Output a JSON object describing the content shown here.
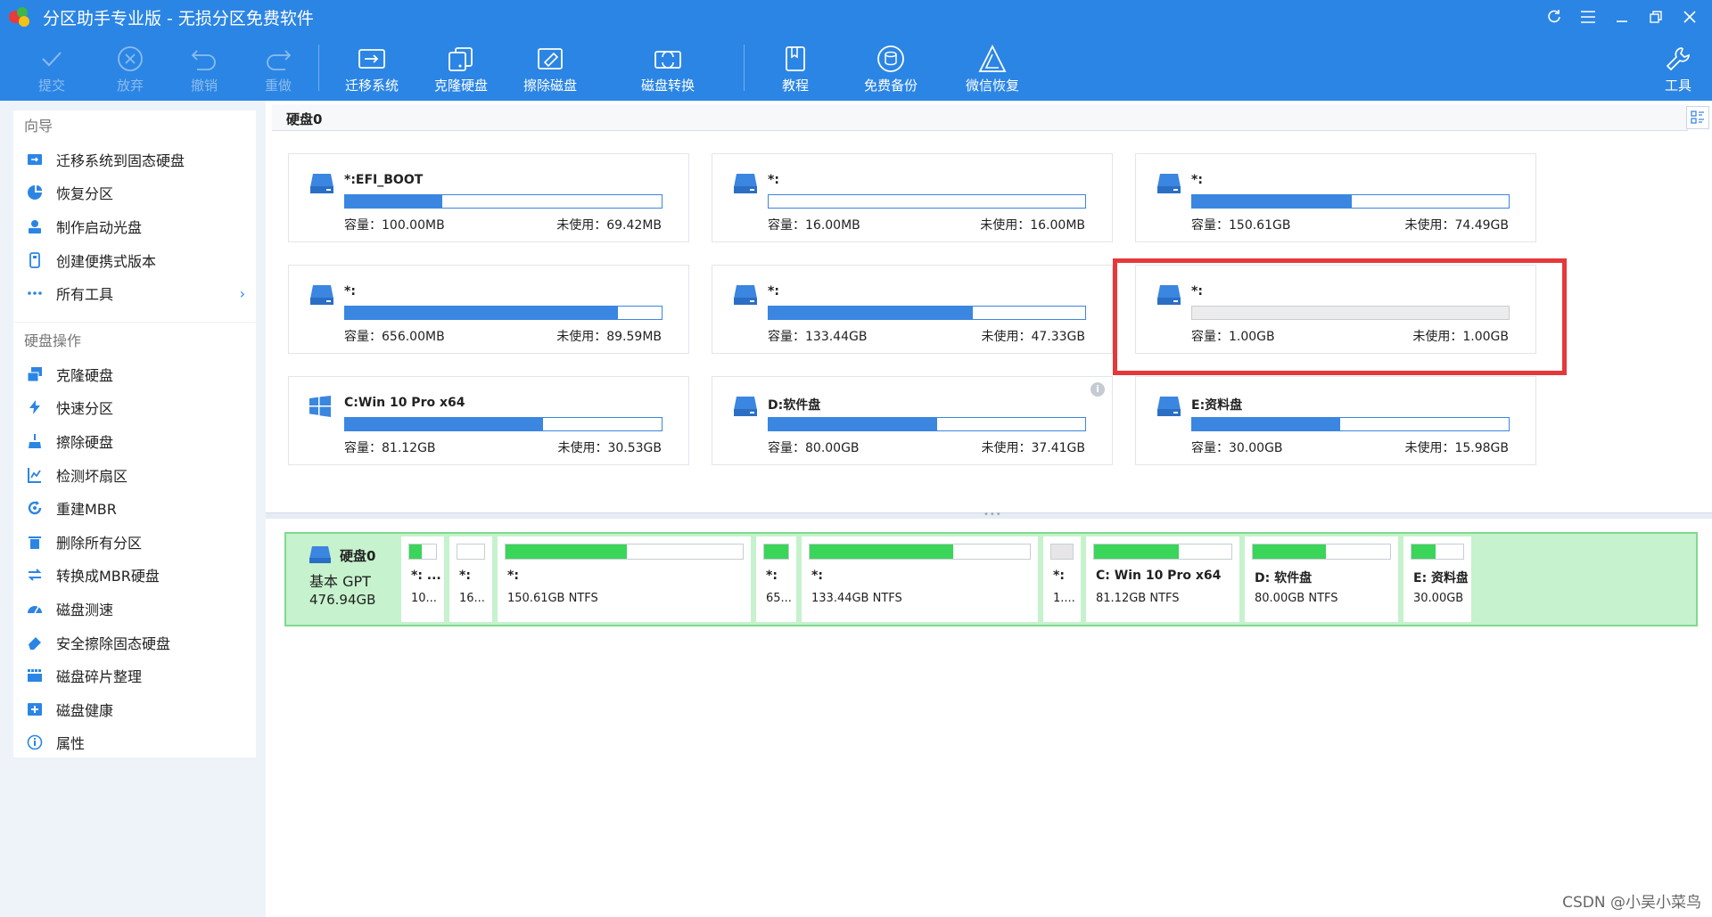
{
  "window": {
    "title": "分区助手专业版 - 无损分区免费软件"
  },
  "toolbar": {
    "commit": "提交",
    "discard": "放弃",
    "undo": "撤销",
    "redo": "重做",
    "migrate_os": "迁移系统",
    "clone_disk": "克隆硬盘",
    "wipe_disk": "擦除磁盘",
    "disk_convert": "磁盘转换",
    "tutorial": "教程",
    "free_backup": "免费备份",
    "wechat_recover": "微信恢复",
    "tools": "工具"
  },
  "sidebar": {
    "wizard_title": "向导",
    "wizard_items": [
      {
        "label": "迁移系统到固态硬盘",
        "icon": "migrate-ssd-icon"
      },
      {
        "label": "恢复分区",
        "icon": "pie-recover-icon"
      },
      {
        "label": "制作启动光盘",
        "icon": "boot-disc-icon"
      },
      {
        "label": "创建便携式版本",
        "icon": "usb-portable-icon"
      },
      {
        "label": "所有工具",
        "icon": "more-dots-icon"
      }
    ],
    "disk_ops_title": "硬盘操作",
    "disk_ops_items": [
      {
        "label": "克隆硬盘",
        "icon": "clone-disk-icon"
      },
      {
        "label": "快速分区",
        "icon": "lightning-icon"
      },
      {
        "label": "擦除硬盘",
        "icon": "broom-icon"
      },
      {
        "label": "检测坏扇区",
        "icon": "bad-sector-icon"
      },
      {
        "label": "重建MBR",
        "icon": "rebuild-mbr-icon"
      },
      {
        "label": "删除所有分区",
        "icon": "trash-icon"
      },
      {
        "label": "转换成MBR硬盘",
        "icon": "convert-icon"
      },
      {
        "label": "磁盘测速",
        "icon": "speedometer-icon"
      },
      {
        "label": "安全擦除固态硬盘",
        "icon": "eraser-icon"
      },
      {
        "label": "磁盘碎片整理",
        "icon": "defrag-icon"
      },
      {
        "label": "磁盘健康",
        "icon": "disk-health-icon"
      },
      {
        "label": "属性",
        "icon": "info-icon"
      }
    ]
  },
  "main": {
    "disk_title": "硬盘0",
    "cards": [
      {
        "name": "*:EFI_BOOT",
        "capacity": "容量：100.00MB",
        "free": "未使用：69.42MB",
        "used_fraction": 0.306,
        "icon": "disk-icon"
      },
      {
        "name": "*:",
        "capacity": "容量：16.00MB",
        "free": "未使用：16.00MB",
        "used_fraction": 0.0,
        "icon": "disk-icon"
      },
      {
        "name": "*:",
        "capacity": "容量：150.61GB",
        "free": "未使用：74.49GB",
        "used_fraction": 0.505,
        "icon": "disk-icon"
      },
      {
        "name": "*:",
        "capacity": "容量：656.00MB",
        "free": "未使用：89.59MB",
        "used_fraction": 0.863,
        "icon": "disk-icon"
      },
      {
        "name": "*:",
        "capacity": "容量：133.44GB",
        "free": "未使用：47.33GB",
        "used_fraction": 0.645,
        "icon": "disk-icon"
      },
      {
        "name": "*:",
        "capacity": "容量：1.00GB",
        "free": "未使用：1.00GB",
        "used_fraction": 0.0,
        "icon": "disk-icon",
        "unallocated": true
      },
      {
        "name": "C:Win 10 Pro x64",
        "capacity": "容量：81.12GB",
        "free": "未使用：30.53GB",
        "used_fraction": 0.624,
        "icon": "windows-icon"
      },
      {
        "name": "D:软件盘",
        "capacity": "容量：80.00GB",
        "free": "未使用：37.41GB",
        "used_fraction": 0.532,
        "icon": "disk-icon",
        "info": "i"
      },
      {
        "name": "E:资料盘",
        "capacity": "容量：30.00GB",
        "free": "未使用：15.98GB",
        "used_fraction": 0.467,
        "icon": "disk-icon"
      }
    ]
  },
  "diskmap": {
    "name": "硬盘0",
    "type": "基本 GPT",
    "size": "476.94GB",
    "partitions": [
      {
        "name": "*: ...",
        "info": "10...",
        "used_fraction": 0.45
      },
      {
        "name": "*:",
        "info": "16...",
        "used_fraction": 0.0
      },
      {
        "name": "*:",
        "info": "150.61GB NTFS",
        "used_fraction": 0.51
      },
      {
        "name": "*:",
        "info": "65...",
        "used_fraction": 1.0
      },
      {
        "name": "*:",
        "info": "133.44GB NTFS",
        "used_fraction": 0.65
      },
      {
        "name": "*:",
        "info": "1....",
        "used_fraction": 0.0,
        "unallocated": true
      },
      {
        "name": "C: Win 10 Pro x64",
        "info": "81.12GB NTFS",
        "used_fraction": 0.62
      },
      {
        "name": "D: 软件盘",
        "info": "80.00GB NTFS",
        "used_fraction": 0.53
      },
      {
        "name": "E: 资料盘",
        "info": "30.00GB ...",
        "used_fraction": 0.47
      }
    ]
  },
  "watermark": "CSDN @小吴小菜鸟",
  "colors": {
    "accent": "#2b85e4",
    "bar_blue": "#3a86e0",
    "bar_green": "#3bd55a",
    "highlight_red": "#e5383b",
    "diskmap_bg": "#c6f2cd"
  }
}
